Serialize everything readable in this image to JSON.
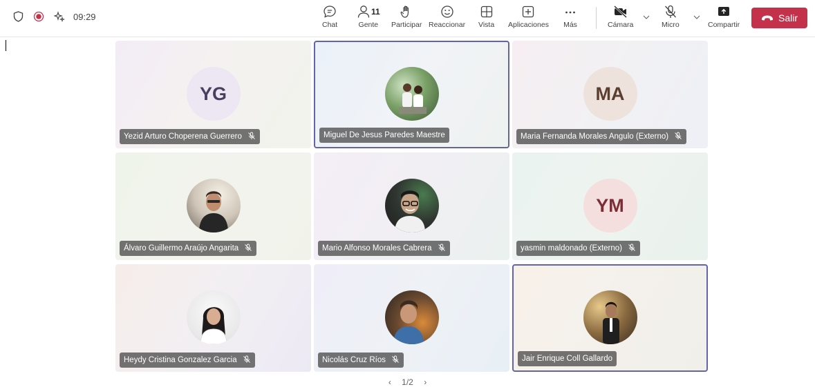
{
  "topbar": {
    "time": "09:29",
    "chat_label": "Chat",
    "people_label": "Gente",
    "people_count": "11",
    "raise_label": "Participar",
    "react_label": "Reaccionar",
    "view_label": "Vista",
    "apps_label": "Aplicaciones",
    "more_label": "Más",
    "camera_label": "Cámara",
    "mic_label": "Micro",
    "share_label": "Compartir",
    "leave_label": "Salir",
    "leave_color": "#c4314b"
  },
  "tiles": [
    {
      "name": "Yezid Arturo Choperena Guerrero",
      "initials": "YG",
      "muted": true,
      "active": false,
      "photo": false
    },
    {
      "name": "Miguel De Jesus Paredes Maestre",
      "initials": "",
      "muted": false,
      "active": true,
      "photo": true
    },
    {
      "name": "Maria Fernanda Morales Angulo (Externo)",
      "initials": "MA",
      "muted": true,
      "active": false,
      "photo": false
    },
    {
      "name": "Álvaro Guillermo Araújo Angarita",
      "initials": "",
      "muted": true,
      "active": false,
      "photo": true
    },
    {
      "name": "Mario Alfonso Morales Cabrera",
      "initials": "",
      "muted": true,
      "active": false,
      "photo": true
    },
    {
      "name": "yasmin maldonado (Externo)",
      "initials": "YM",
      "muted": true,
      "active": false,
      "photo": false
    },
    {
      "name": "Heydy Cristina Gonzalez Garcia",
      "initials": "",
      "muted": true,
      "active": false,
      "photo": true
    },
    {
      "name": "Nicolás Cruz Ríos",
      "initials": "",
      "muted": true,
      "active": false,
      "photo": true
    },
    {
      "name": "Jair Enrique Coll Gallardo",
      "initials": "",
      "muted": false,
      "active": true,
      "photo": true
    }
  ],
  "pager": {
    "text": "1/2"
  },
  "colors": {
    "accent": "#6264a7",
    "danger": "#c4314b",
    "recording": "#c4314b"
  }
}
